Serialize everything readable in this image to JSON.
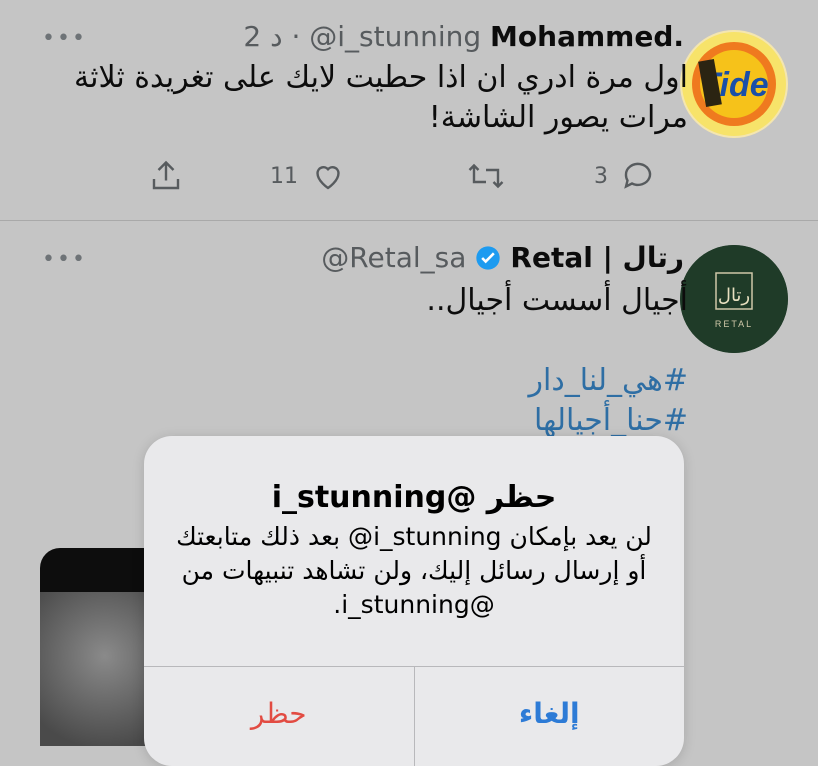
{
  "tweet1": {
    "name": "Mohammed.",
    "handle": "@i_stunning",
    "time": "2 د",
    "text_line1": "اول مرة ادري ان اذا حطيت لايك على تغريدة ثلاثة",
    "text_line2": "مرات يصور الشاشة!",
    "reply_count": "3",
    "like_count": "11",
    "avatar_logo": "Tide"
  },
  "tweet2": {
    "name": "رتال | Retal",
    "handle": "@Retal_sa",
    "text_line1": "أجيال أسست أجيال..",
    "hashtag1": "#هي_لنا_دار",
    "hashtag2": "#حنا_أجيالها",
    "avatar_logo": "رتال",
    "avatar_sub": "RETAL"
  },
  "alert": {
    "title": "حظر @i_stunning",
    "line1": "لن يعد بإمكان i_stunning@ بعد ذلك متابعتك",
    "line2": "أو إرسال رسائل إليك، ولن تشاهد تنبيهات من",
    "line3": "@i_stunning.",
    "block_label": "حظر",
    "cancel_label": "إلغاء"
  },
  "colors": {
    "hashtag": "#2e6ea4",
    "destructive": "#e24b42",
    "primary_action": "#2d7bd6",
    "verified": "#1d9bf0"
  },
  "icons": [
    "more-icon",
    "share-icon",
    "like-icon",
    "retweet-icon",
    "reply-icon",
    "verified-icon"
  ]
}
